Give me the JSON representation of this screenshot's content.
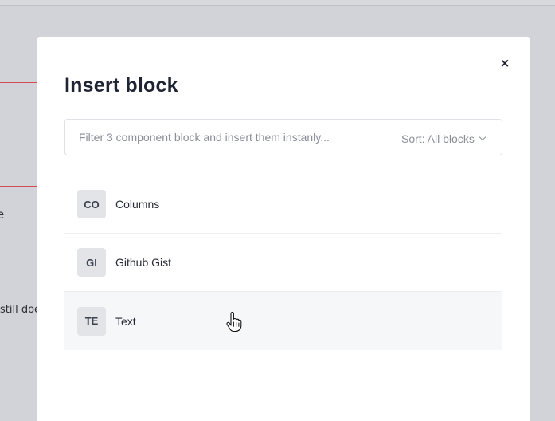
{
  "background": {
    "heading_fragment": "e",
    "body_fragment": "still doe"
  },
  "modal": {
    "close_label": "×",
    "title": "Insert block",
    "search": {
      "value": "",
      "placeholder": "Filter 3 component block and insert them instanly..."
    },
    "sort": {
      "label": "Sort: All blocks",
      "icon": "chevron-down-icon"
    },
    "blocks": [
      {
        "badge": "CO",
        "name": "Columns"
      },
      {
        "badge": "GI",
        "name": "Github Gist"
      },
      {
        "badge": "TE",
        "name": "Text",
        "hovered": true
      }
    ]
  },
  "colors": {
    "overlay": "#d2d3d8",
    "title": "#1f2433",
    "badge_bg": "#e2e4e8",
    "hover_row": "#f6f7f9",
    "accent_line": "#d44a55"
  },
  "cursor": {
    "icon": "hand-pointer-icon"
  }
}
